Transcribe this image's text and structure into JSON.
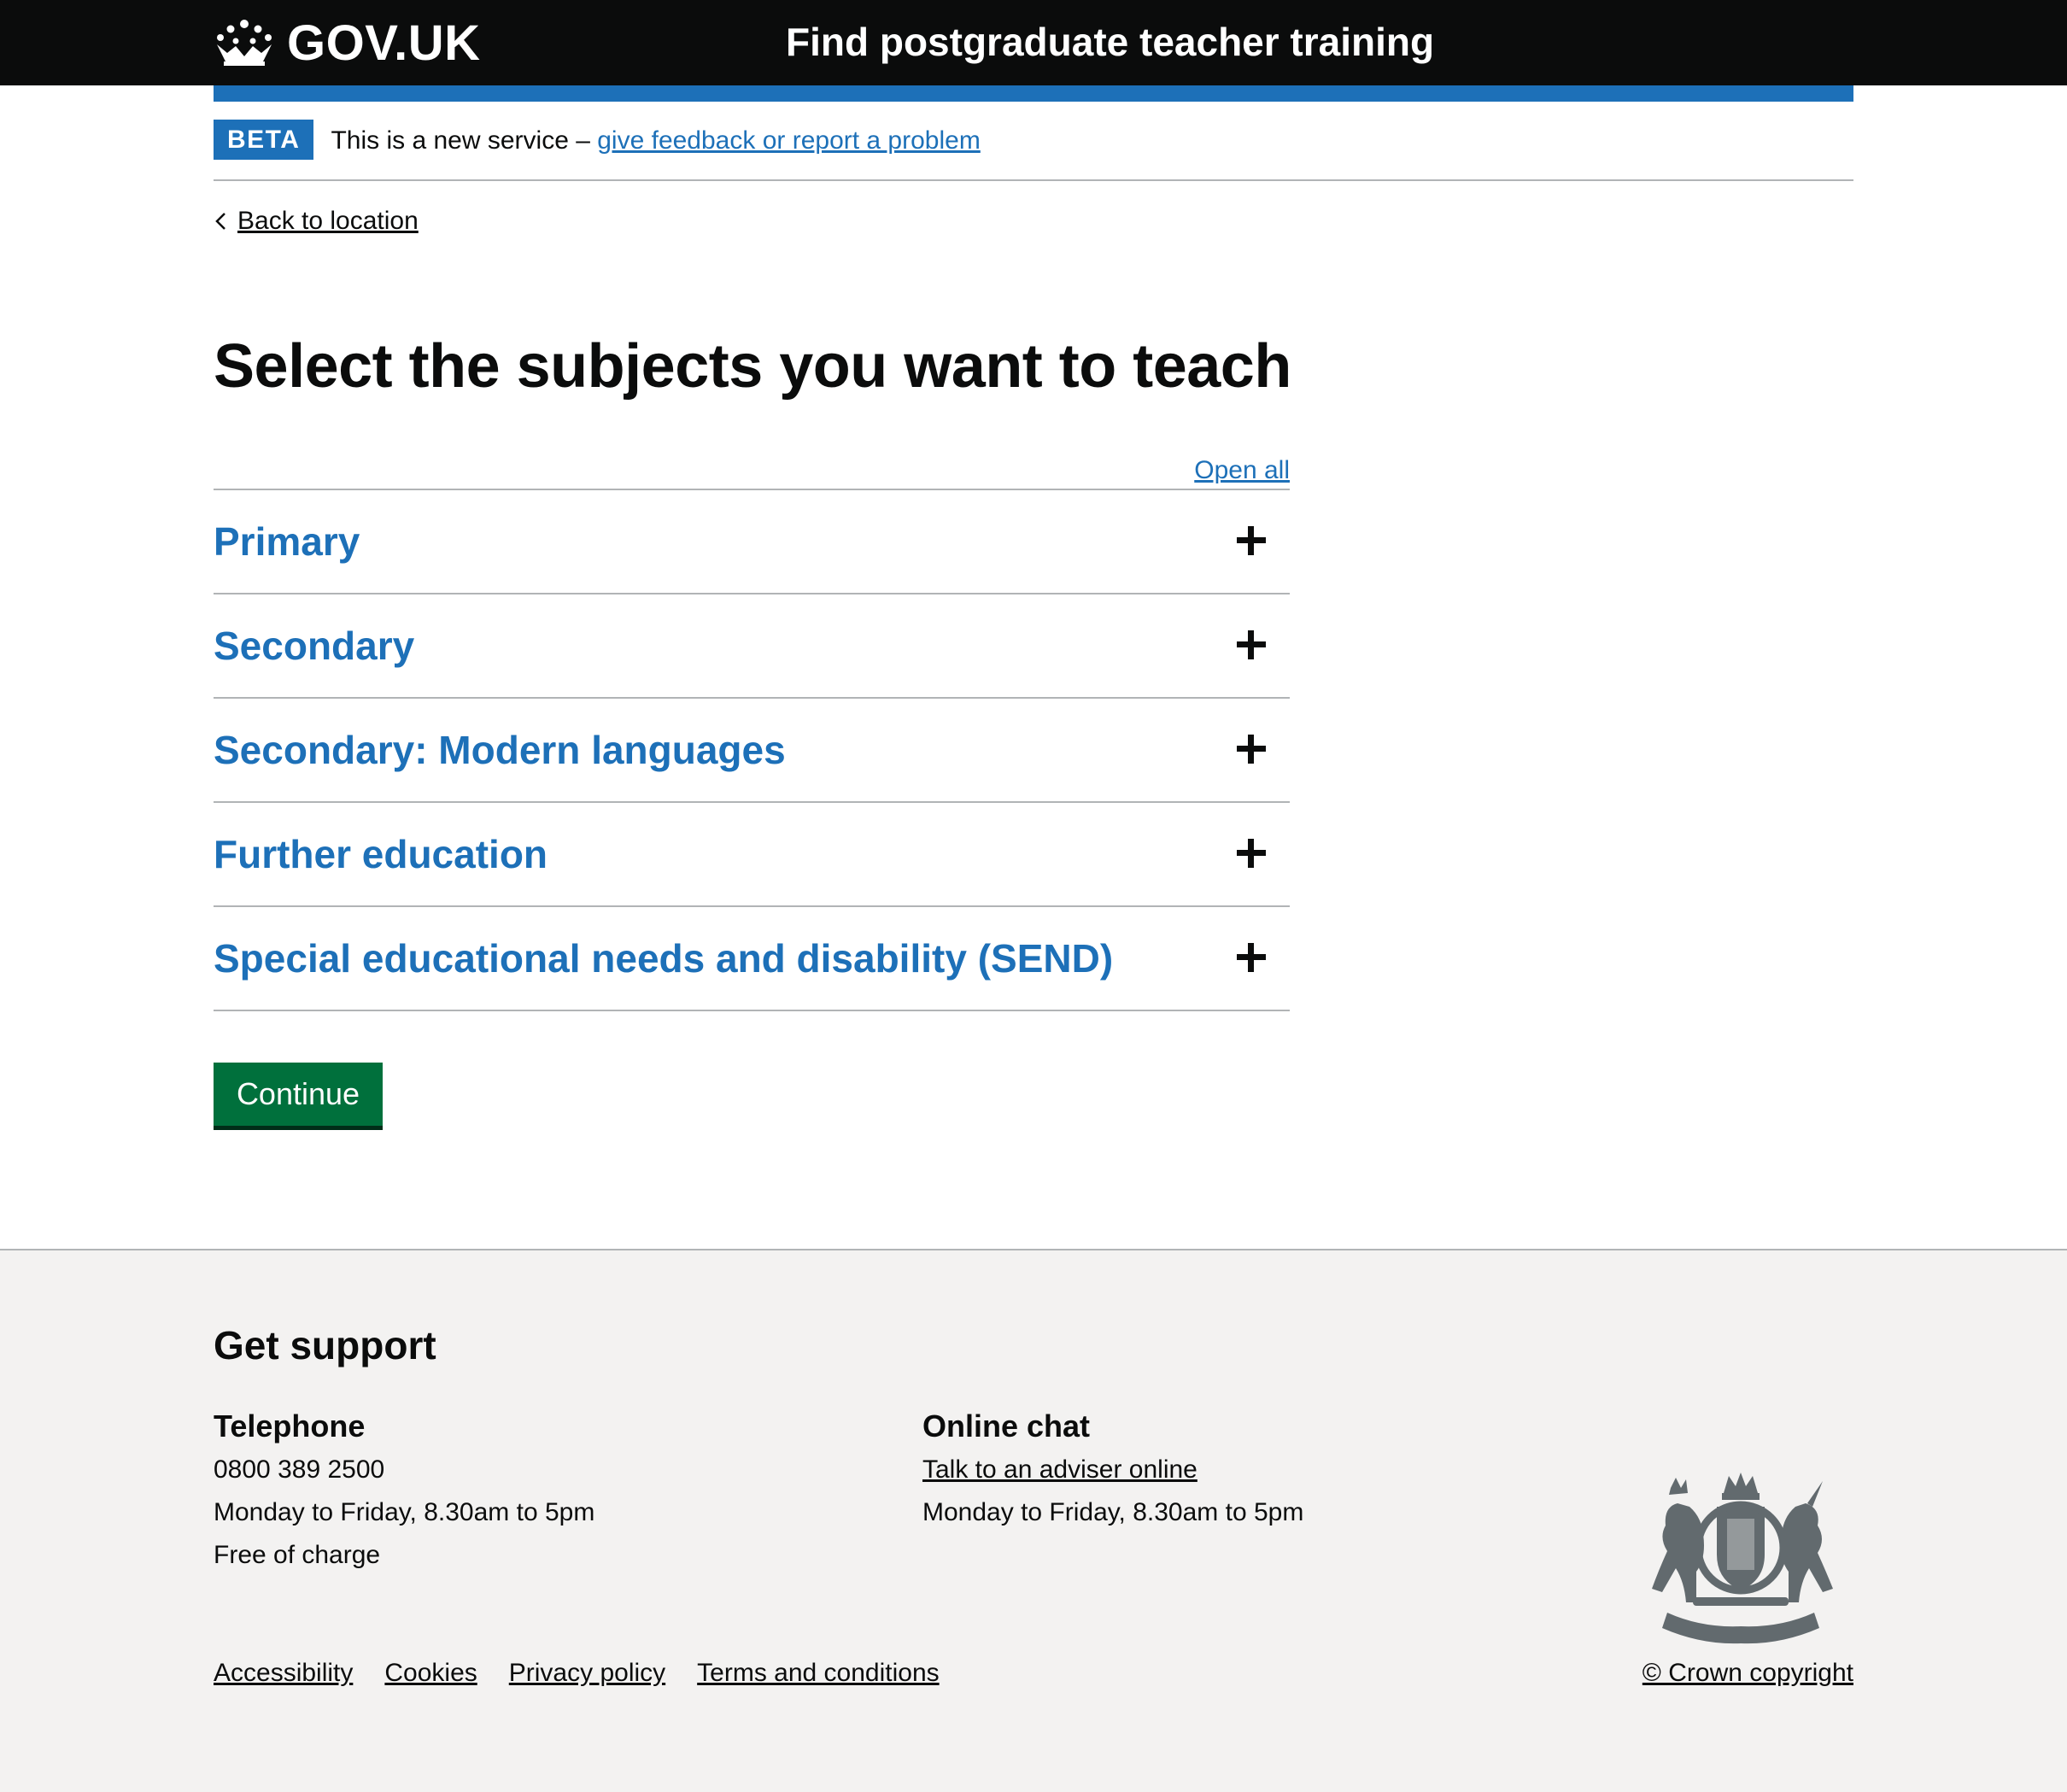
{
  "header": {
    "logo_text": "GOV.UK",
    "service_name": "Find postgraduate teacher training"
  },
  "phase_banner": {
    "tag": "BETA",
    "text": "This is a new service – ",
    "link": "give feedback or report a problem"
  },
  "back_link": "Back to location",
  "page_title": "Select the subjects you want to teach",
  "accordion": {
    "open_all": "Open all",
    "sections": [
      {
        "label": "Primary"
      },
      {
        "label": "Secondary"
      },
      {
        "label": "Secondary: Modern languages"
      },
      {
        "label": "Further education"
      },
      {
        "label": "Special educational needs and disability (SEND)"
      }
    ]
  },
  "continue_button": "Continue",
  "footer": {
    "title": "Get support",
    "telephone": {
      "heading": "Telephone",
      "number": "0800 389 2500",
      "hours": "Monday to Friday, 8.30am to 5pm",
      "cost": "Free of charge"
    },
    "chat": {
      "heading": "Online chat",
      "link": "Talk to an adviser online",
      "hours": "Monday to Friday, 8.30am to 5pm"
    },
    "links": [
      "Accessibility",
      "Cookies",
      "Privacy policy",
      "Terms and conditions"
    ],
    "copyright": "© Crown copyright",
    "crest_icon": "royal-coat-of-arms-icon"
  },
  "colors": {
    "header_bg": "#0b0c0c",
    "brand_blue": "#1d70b8",
    "button_green": "#00703c",
    "footer_bg": "#f3f2f1"
  }
}
